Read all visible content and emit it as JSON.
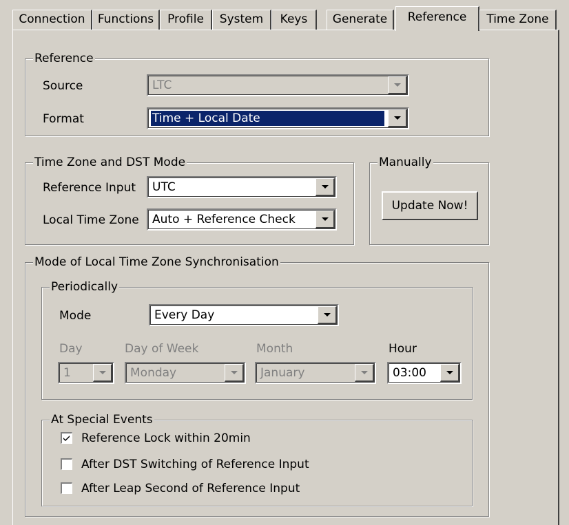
{
  "tabs": [
    "Connection",
    "Functions",
    "Profile",
    "System",
    "Keys",
    "Generate",
    "Reference",
    "Time Zone"
  ],
  "active_tab": "Reference",
  "reference": {
    "title": "Reference",
    "source_label": "Source",
    "source_value": "LTC",
    "format_label": "Format",
    "format_value": "Time + Local Date"
  },
  "timezone": {
    "title": "Time Zone and DST Mode",
    "ref_input_label": "Reference Input",
    "ref_input_value": "UTC",
    "local_tz_label": "Local Time Zone",
    "local_tz_value": "Auto + Reference Check"
  },
  "manually": {
    "title": "Manually",
    "button": "Update Now!"
  },
  "sync": {
    "title": "Mode of Local Time Zone Synchronisation",
    "periodically": {
      "title": "Periodically",
      "mode_label": "Mode",
      "mode_value": "Every Day",
      "day_label": "Day",
      "day_value": "1",
      "dow_label": "Day of Week",
      "dow_value": "Monday",
      "month_label": "Month",
      "month_value": "January",
      "hour_label": "Hour",
      "hour_value": "03:00"
    },
    "special": {
      "title": "At Special Events",
      "items": [
        {
          "label": "Reference Lock within 20min",
          "checked": true
        },
        {
          "label": "After DST Switching of Reference Input",
          "checked": false
        },
        {
          "label": "After Leap Second of Reference Input",
          "checked": false
        }
      ]
    }
  }
}
